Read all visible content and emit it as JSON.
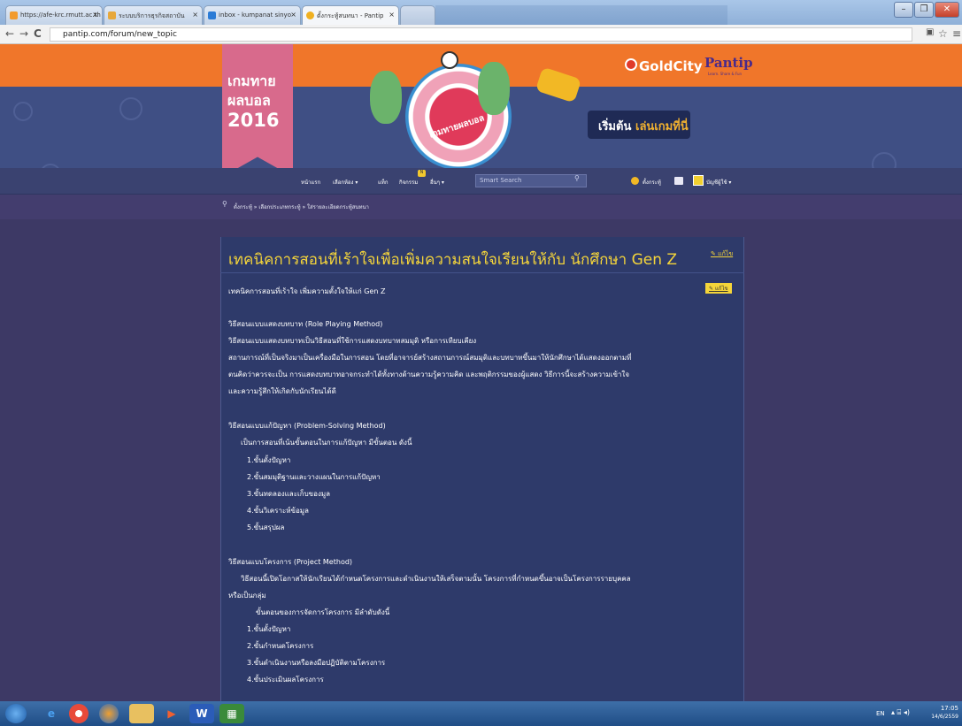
{
  "browser": {
    "tabs": [
      {
        "label": "https://afe-krc.rmutt.ac.th",
        "icon": "page-icon"
      },
      {
        "label": "ระบบบริการธุรกิจสถาบัน",
        "icon": "page-icon"
      },
      {
        "label": "inbox - kumpanat sinyo",
        "icon": "mail-icon"
      },
      {
        "label": "ตั้งกระทู้สนทนา - Pantip",
        "icon": "pantip-icon"
      },
      {
        "label": "",
        "icon": "blank-tab"
      }
    ],
    "address": "pantip.com/forum/new_topic"
  },
  "header": {
    "goldcity": "GoldCity",
    "pantip": "Pantip",
    "pantip_tagline": "Learn. Share & Fun"
  },
  "banner": {
    "badge_line1": "เกมทาย",
    "badge_line2": "ผลบอล",
    "badge_year": "2016",
    "emblem_text": "เกมทายผลบอล",
    "cta_prefix": "เริ่มต้น",
    "cta_highlight": "เล่นเกมที่นี่"
  },
  "nav": {
    "items": [
      "หน้าแรก",
      "เลือกห้อง ▾",
      "แท็ก",
      "กิจกรรม",
      "อื่นๆ ▾"
    ],
    "activity_badge": "N",
    "search_placeholder": "Smart Search",
    "new_topic": "ตั้งกระทู้",
    "account": "บัญชีผู้ใช้ ▾"
  },
  "breadcrumb": "ตั้งกระทู้ » เลือกประเภทกระทู้ » ใส่รายละเอียดกระทู้สนทนา",
  "post": {
    "title": "เทคนิคการสอนที่เร้าใจเพื่อเพิ่มความสนใจเรียนให้กับ นักศึกษา Gen Z",
    "edit_title": "แก้ไข",
    "edit_body": "แก้ไข",
    "lines": [
      "เทคนิคการสอนที่เร้าใจ  เพิ่มความตั้งใจให้แก่  Gen Z",
      "วิธีสอนแบบแสดงบทบาท (Role Playing Method)",
      "วิธีสอนแบบแสดงบทบาทเป็นวิธีสอนที่ใช้การแสดงบทบาทสมมุติ หรือการเทียบเคียง",
      "สถานการณ์ที่เป็นจริงมาเป็นเครื่องมือในการสอน โดยที่อาจารย์สร้างสถานการณ์สมมุติและบทบาทขึ้นมาให้นักศึกษาได้แสดงออกตามที่",
      "ตนคิดว่าควรจะเป็น การแสดงบทบาทอาจกระทำได้ทั้งทางด้านความรู้ความคิด และพฤติกรรมของผู้แสดง วิธีการนี้จะสร้างความเข้าใจ",
      "และความรู้สึกให้เกิดกับนักเรียนได้ดี",
      "วิธีสอนแบบแก้ปัญหา (Problem-Solving Method)",
      "เป็นการสอนที่เน้นขั้นตอนในการแก้ปัญหา มีขั้นตอน ดังนี้",
      "1.ขั้นตั้งปัญหา",
      "2.ขั้นสมมุติฐานและวางแผนในการแก้ปัญหา",
      "3.ขั้นทดลองและเก็บของมูล",
      "4.ขั้นวิเคราะห์ข้อมูล",
      "5.ขั้นสรุปผล",
      "วิธีสอนแบบโครงการ (Project Method)",
      "วิธีสอนนี้เปิดโอกาสให้นักเรียนได้กำหนดโครงการและดำเนินงานให้เสร็จตามนั้น โครงการที่กำหนดขึ้นอาจเป็นโครงการรายบุคคล",
      "หรือเป็นกลุ่ม",
      "ขั้นตอนของการจัดการโครงการ มีลำดับดังนี้",
      "1.ขั้นตั้งปัญหา",
      "2.ขั้นกำหนดโครงการ",
      "3.ขั้นดำเนินงานหรือลงมือปฏิบัติตามโครงการ",
      "4.ขั้นประเมินผลโครงการ"
    ]
  },
  "taskbar": {
    "lang": "EN",
    "time": "17:05",
    "date": "14/6/2559"
  },
  "colors": {
    "orange": "#f0762a",
    "navy": "#2e3a6a",
    "gold": "#f5d53a"
  }
}
